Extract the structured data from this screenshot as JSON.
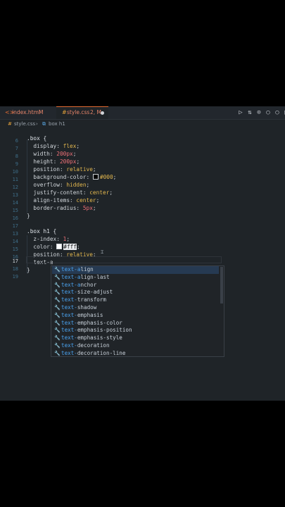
{
  "tabs": [
    {
      "icon": "<>",
      "name": "index.html",
      "status": "M"
    },
    {
      "icon": "#",
      "name": "style.css",
      "status": "2, M"
    }
  ],
  "actions": [
    "▷",
    "⇅",
    "⊙",
    "○",
    "○",
    "□"
  ],
  "breadcrumb": {
    "file": "style.css",
    "separator": "›",
    "symbol": "box h1"
  },
  "line_numbers": [
    "6",
    "7",
    "8",
    "9",
    "10",
    "11",
    "12",
    "13",
    "14",
    "15",
    "16",
    "17",
    "18",
    "19"
  ],
  "code": {
    "l1_sel": ".box {",
    "l2_prop": "display",
    "l2_val": "flex",
    "l3_prop": "width",
    "l3_val": "200px",
    "l4_prop": "height",
    "l4_val": "200px",
    "l5_prop": "position",
    "l5_val": "relative",
    "l6_prop": "background-color",
    "l6_val": "#000",
    "l7_prop": "overflow",
    "l7_val": "hidden",
    "l8_prop": "justify-content",
    "l8_val": "center",
    "l9_prop": "align-items",
    "l9_val": "center",
    "l10_prop": "border-radius",
    "l10_val": "5px",
    "l11": "}",
    "l13_sel": ".box h1 {",
    "l14_prop": "z-index",
    "l14_val": "1",
    "l15_prop": "color",
    "l15_val": "#fff",
    "l16_prop": "position",
    "l16_val": "relative",
    "l17": "text-a",
    "l18": "}"
  },
  "suggestions": [
    {
      "match": "text-a",
      "rest": "lign"
    },
    {
      "match": "text-a",
      "rest": "lign-last"
    },
    {
      "match": "text-a",
      "rest": "nchor"
    },
    {
      "match": "text-",
      "rest": "size-adjust"
    },
    {
      "match": "text-",
      "rest": "transform"
    },
    {
      "match": "text-",
      "rest": "shadow"
    },
    {
      "match": "text-",
      "rest": "emphasis"
    },
    {
      "match": "text-",
      "rest": "emphasis-color"
    },
    {
      "match": "text-",
      "rest": "emphasis-position"
    },
    {
      "match": "text-",
      "rest": "emphasis-style"
    },
    {
      "match": "text-",
      "rest": "decoration"
    },
    {
      "match": "text-",
      "rest": "decoration-line"
    }
  ],
  "suggestion_icon": "🔧",
  "colors": {
    "accent": "#e36c33",
    "selection": "#263a52",
    "match": "#4aa3f0"
  }
}
